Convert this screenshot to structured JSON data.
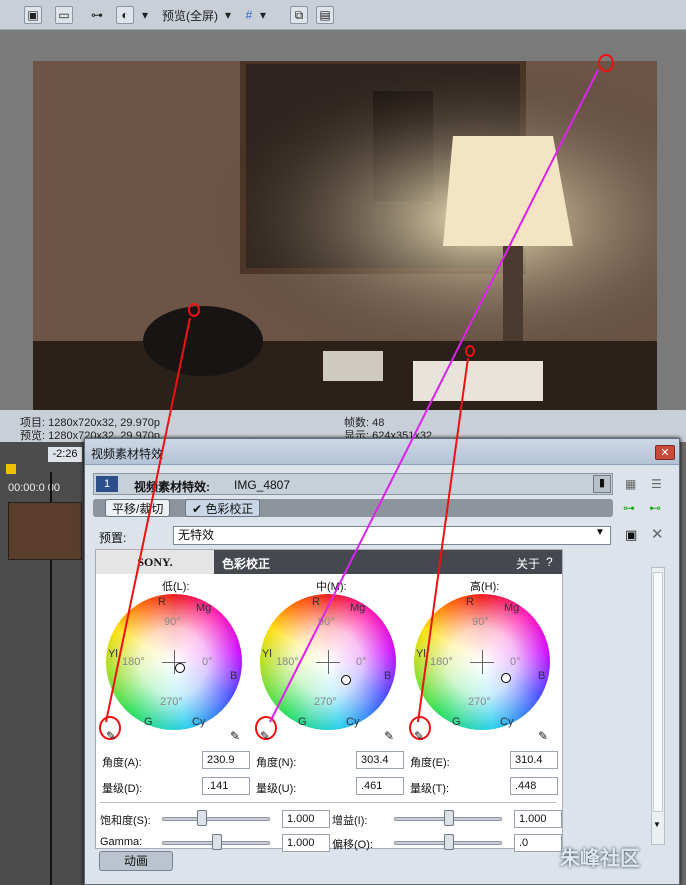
{
  "toolbar": {
    "preview_label": "预览(全屏)"
  },
  "info": {
    "project": "项目: 1280x720x32, 29.970p",
    "preview": "预览: 1280x720x32, 29.970p",
    "frame": "帧数: 48",
    "display": "显示: 624x351x32"
  },
  "timeline": {
    "duration": "-2:26",
    "timecode": "00:00:0 00"
  },
  "dialog": {
    "title": "视频素材特效",
    "track_badge": "1",
    "fx_label": "视频素材特效:",
    "clip_name": "IMG_4807",
    "chain": [
      "平移/裁切",
      "色彩校正"
    ],
    "preset_label": "预置:",
    "preset_value": "无特效",
    "brand": "SONY.",
    "plugin_name": "色彩校正",
    "about": "关于",
    "help": "?",
    "animate": "动画"
  },
  "wheels": [
    {
      "header": "低(L):",
      "angle_label": "角度(A):",
      "angle": "230.9",
      "amount_label": "量级(D):",
      "amount": ".141"
    },
    {
      "header": "中(M):",
      "angle_label": "角度(N):",
      "angle": "303.4",
      "amount_label": "量级(U):",
      "amount": ".461"
    },
    {
      "header": "高(H):",
      "angle_label": "角度(E):",
      "angle": "310.4",
      "amount_label": "量级(T):",
      "amount": ".448"
    }
  ],
  "wheel_marks": {
    "r": "R",
    "mg": "Mg",
    "b": "B",
    "cy": "Cy",
    "g": "G",
    "yl": "Yl",
    "d90": "90°",
    "d180": "180°",
    "d0": "0°",
    "d270": "270°"
  },
  "sliders": {
    "saturation_label": "饱和度(S):",
    "saturation": "1.000",
    "gamma_label": "Gamma:",
    "gamma": "1.000",
    "gain_label": "增益(I):",
    "gain": "1.000",
    "offset_label": "偏移(O):",
    "offset": ".0"
  },
  "watermark": "朱峰社区"
}
